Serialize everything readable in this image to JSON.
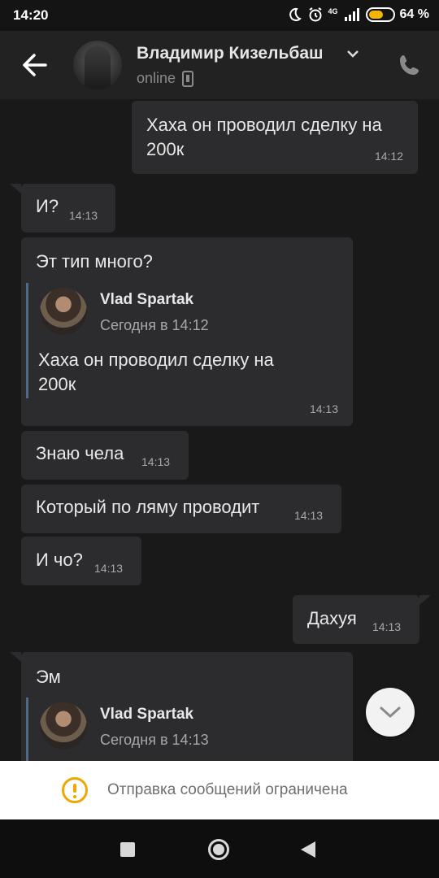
{
  "status_bar": {
    "time": "14:20",
    "network": "4G",
    "battery_percent_text": "64 %",
    "battery_level": 0.64,
    "icons": [
      "moon-icon",
      "alarm-icon",
      "signal-icon",
      "battery-icon"
    ]
  },
  "header": {
    "contact_name": "Владимир Кизельбаш",
    "status": "online",
    "icons": [
      "back-arrow-icon",
      "chevron-down-icon",
      "mobile-device-icon",
      "phone-call-icon"
    ]
  },
  "messages": [
    {
      "direction": "out",
      "text": "Хаха он проводил сделку на 200к",
      "time": "14:12"
    },
    {
      "direction": "in",
      "text": "И?",
      "time": "14:13"
    },
    {
      "direction": "in",
      "text": "Эт тип много?",
      "time": "14:13",
      "reply": {
        "author": "Vlad Spartak",
        "date": "Сегодня в 14:12",
        "text": "Хаха он проводил сделку на 200к"
      }
    },
    {
      "direction": "in",
      "text": "Знаю чела",
      "time": "14:13"
    },
    {
      "direction": "in",
      "text": "Который по ляму проводит",
      "time": "14:13"
    },
    {
      "direction": "in",
      "text": "И чо?",
      "time": "14:13"
    },
    {
      "direction": "out",
      "text": "Дахуя",
      "time": "14:13"
    },
    {
      "direction": "in",
      "text": "Эм",
      "time": "",
      "reply": {
        "author": "Vlad Spartak",
        "date": "Сегодня в 14:13"
      }
    }
  ],
  "restriction": {
    "text": "Отправка сообщений ограничена",
    "icon": "warning-icon",
    "color": "#f0a800"
  },
  "nav": {
    "icons": [
      "recent-apps-icon",
      "home-icon",
      "back-icon"
    ]
  }
}
